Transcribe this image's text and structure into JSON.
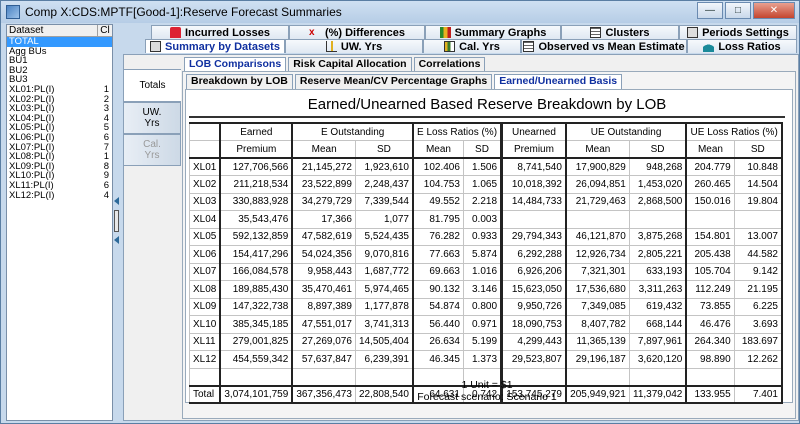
{
  "window": {
    "title": "Comp X:CDS:MPTF[Good-1]:Reserve Forecast Summaries",
    "min": "—",
    "max": "□",
    "close": "✕"
  },
  "datasets": {
    "col1": "Dataset",
    "col2": "Cl",
    "items": [
      {
        "name": "TOTAL",
        "count": ""
      },
      {
        "name": "Agg BUs",
        "count": ""
      },
      {
        "name": "BU1",
        "count": ""
      },
      {
        "name": "BU2",
        "count": ""
      },
      {
        "name": "BU3",
        "count": ""
      },
      {
        "name": "XL01:PL(I)",
        "count": "1"
      },
      {
        "name": "XL02:PL(I)",
        "count": "2"
      },
      {
        "name": "XL03:PL(I)",
        "count": "3"
      },
      {
        "name": "XL04:PL(I)",
        "count": "4"
      },
      {
        "name": "XL05:PL(I)",
        "count": "5"
      },
      {
        "name": "XL06:PL(I)",
        "count": "6"
      },
      {
        "name": "XL07:PL(I)",
        "count": "7"
      },
      {
        "name": "XL08:PL(I)",
        "count": "1"
      },
      {
        "name": "XL09:PL(I)",
        "count": "8"
      },
      {
        "name": "XL10:PL(I)",
        "count": "9"
      },
      {
        "name": "XL11:PL(I)",
        "count": "6"
      },
      {
        "name": "XL12:PL(I)",
        "count": "4"
      }
    ]
  },
  "top_tabs": {
    "incurred": "Incurred Losses",
    "differences": "(%) Differences",
    "graphs": "Summary Graphs",
    "clusters": "Clusters",
    "periods": "Periods Settings",
    "by_datasets": "Summary by Datasets",
    "uw": "UW. Yrs",
    "cal": "Cal. Yrs",
    "observed": "Observed vs Mean Estimate",
    "loss_ratios": "Loss Ratios"
  },
  "side_tabs": {
    "totals": "Totals",
    "uw": "UW. Yrs",
    "cal": "Cal. Yrs"
  },
  "sub_tabs1": {
    "lob": "LOB Comparisons",
    "risk": "Risk Capital Allocation",
    "corr": "Correlations"
  },
  "sub_tabs2": {
    "breakdown": "Breakdown by LOB",
    "meancv": "Reserve Mean/CV Percentage Graphs",
    "earned": "Earned/Unearned Basis"
  },
  "report": {
    "title": "Earned/Unearned Based Reserve Breakdown by LOB",
    "headers": {
      "earned": "Earned",
      "premium": "Premium",
      "e_out": "E Outstanding",
      "e_lr": "E Loss Ratios (%)",
      "unearned": "Unearned",
      "ue_out": "UE Outstanding",
      "ue_lr": "UE Loss Ratios (%)",
      "mean": "Mean",
      "sd": "SD"
    },
    "rows": [
      [
        "XL01",
        "127,706,566",
        "21,145,272",
        "1,923,610",
        "102.406",
        "1.506",
        "8,741,540",
        "17,900,829",
        "948,268",
        "204.779",
        "10.848"
      ],
      [
        "XL02",
        "211,218,534",
        "23,522,899",
        "2,248,437",
        "104.753",
        "1.065",
        "10,018,392",
        "26,094,851",
        "1,453,020",
        "260.465",
        "14.504"
      ],
      [
        "XL03",
        "330,883,928",
        "34,279,729",
        "7,339,544",
        "49.552",
        "2.218",
        "14,484,733",
        "21,729,463",
        "2,868,500",
        "150.016",
        "19.804"
      ],
      [
        "XL04",
        "35,543,476",
        "17,366",
        "1,077",
        "81.795",
        "0.003",
        "",
        "",
        "",
        "",
        ""
      ],
      [
        "XL05",
        "592,132,859",
        "47,582,619",
        "5,524,435",
        "76.282",
        "0.933",
        "29,794,343",
        "46,121,870",
        "3,875,268",
        "154.801",
        "13.007"
      ],
      [
        "XL06",
        "154,417,296",
        "54,024,356",
        "9,070,816",
        "77.663",
        "5.874",
        "6,292,288",
        "12,926,734",
        "2,805,221",
        "205.438",
        "44.582"
      ],
      [
        "XL07",
        "166,084,578",
        "9,958,443",
        "1,687,772",
        "69.663",
        "1.016",
        "6,926,206",
        "7,321,301",
        "633,193",
        "105.704",
        "9.142"
      ],
      [
        "XL08",
        "189,885,430",
        "35,470,461",
        "5,974,465",
        "90.132",
        "3.146",
        "15,623,050",
        "17,536,680",
        "3,311,263",
        "112.249",
        "21.195"
      ],
      [
        "XL09",
        "147,322,738",
        "8,897,389",
        "1,177,878",
        "54.874",
        "0.800",
        "9,950,726",
        "7,349,085",
        "619,432",
        "73.855",
        "6.225"
      ],
      [
        "XL10",
        "385,345,185",
        "47,551,017",
        "3,741,313",
        "56.440",
        "0.971",
        "18,090,753",
        "8,407,782",
        "668,144",
        "46.476",
        "3.693"
      ],
      [
        "XL11",
        "279,001,825",
        "27,269,076",
        "14,505,404",
        "26.634",
        "5.199",
        "4,299,443",
        "11,365,139",
        "7,897,961",
        "264.340",
        "183.697"
      ],
      [
        "XL12",
        "454,559,342",
        "57,637,847",
        "6,239,391",
        "46.345",
        "1.373",
        "29,523,807",
        "29,196,187",
        "3,620,120",
        "98.890",
        "12.262"
      ]
    ],
    "total": [
      "Total",
      "3,074,101,759",
      "367,356,473",
      "22,808,540",
      "64.631",
      "0.742",
      "153,745,279",
      "205,949,921",
      "11,379,042",
      "133.955",
      "7.401"
    ],
    "unit": "1 Unit = $1",
    "scenario": "Forecast scenario: Scenario 1"
  }
}
